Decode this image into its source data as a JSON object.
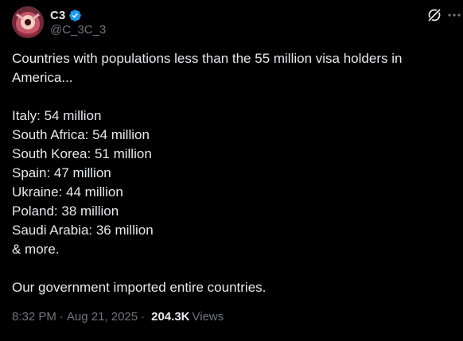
{
  "author": {
    "display_name": "C3",
    "handle": "@C_3C_3",
    "verified": true
  },
  "tweet": {
    "intro": "Countries with populations less than the 55 million visa holders in America...",
    "list": [
      "Italy: 54 million",
      "South Africa: 54 million",
      "South Korea: 51 million",
      "Spain: 47 million",
      "Ukraine: 44 million",
      "Poland: 38 million",
      "Saudi Arabia: 36 million",
      "& more."
    ],
    "closing": "Our government imported entire countries.",
    "time": "8:32 PM",
    "date": "Aug 21, 2025",
    "separator": "·",
    "views_count": "204.3K",
    "views_label": "Views"
  },
  "icons": {
    "verified": "verified-badge-icon",
    "grok": "grok-icon",
    "more": "more-options-icon"
  },
  "colors": {
    "background": "#000000",
    "text": "#e7e9ea",
    "secondary": "#71767b",
    "verified": "#1d9bf0"
  }
}
